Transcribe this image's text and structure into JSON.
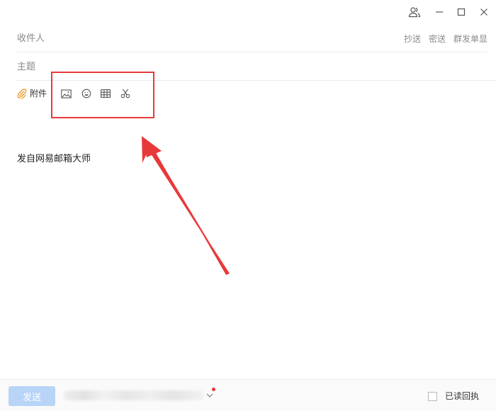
{
  "fields": {
    "to_placeholder": "收件人",
    "subject_placeholder": "主题",
    "links": {
      "cc": "抄送",
      "bcc": "密送",
      "separate_send": "群发单显"
    }
  },
  "toolbar": {
    "attach_label": "附件",
    "icons": [
      "image-icon",
      "emoji-icon",
      "table-icon",
      "scissors-icon"
    ]
  },
  "body": {
    "signature": "发自网易邮箱大师"
  },
  "footer": {
    "send_label": "发送",
    "read_receipt_label": "已读回执",
    "read_receipt_checked": false
  },
  "annotation": {
    "color": "#e8393a"
  },
  "colors": {
    "send_button": "#b8d4f7",
    "attach_icon": "#e8a33a"
  }
}
